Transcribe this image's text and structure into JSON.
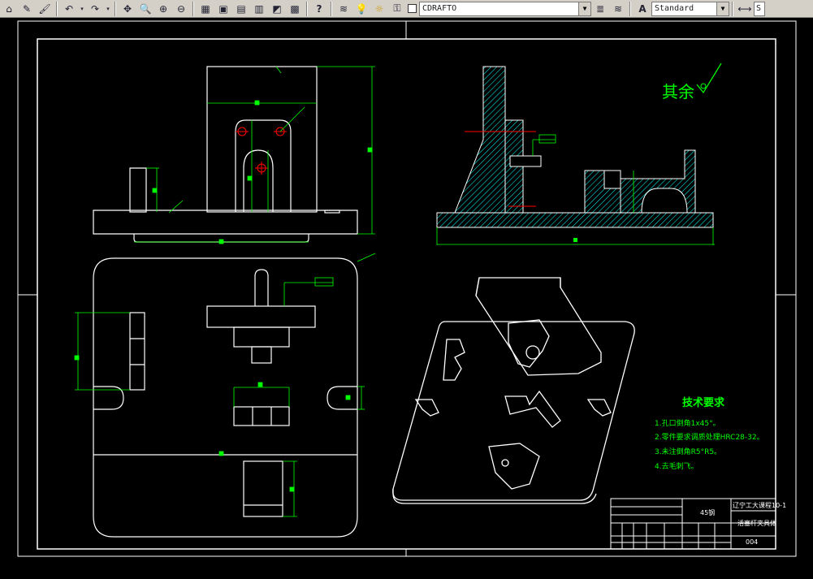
{
  "toolbar": {
    "layer_name": "CDRAFTO",
    "text_style": "Standard",
    "dim_style_cut": "S"
  },
  "drawing": {
    "roughness_note": "其余",
    "tech_title": "技术要求",
    "tech_items": [
      "1.孔口倒角1x45°。",
      "2.零件要求调质处理HRC28-32。",
      "3.未注倒角R5°R5。",
      "4.去毛刺飞。"
    ],
    "title_block": {
      "school": "辽宁工大课程10-1",
      "part_name": "活塞杆夹具体",
      "material": "45钢",
      "drawing_no": "004"
    }
  },
  "colors": {
    "background": "#000000",
    "lines": "#ffffff",
    "dimensions": "#00ff00",
    "hatch": "#00ffff",
    "center_marks": "#ff0000"
  }
}
